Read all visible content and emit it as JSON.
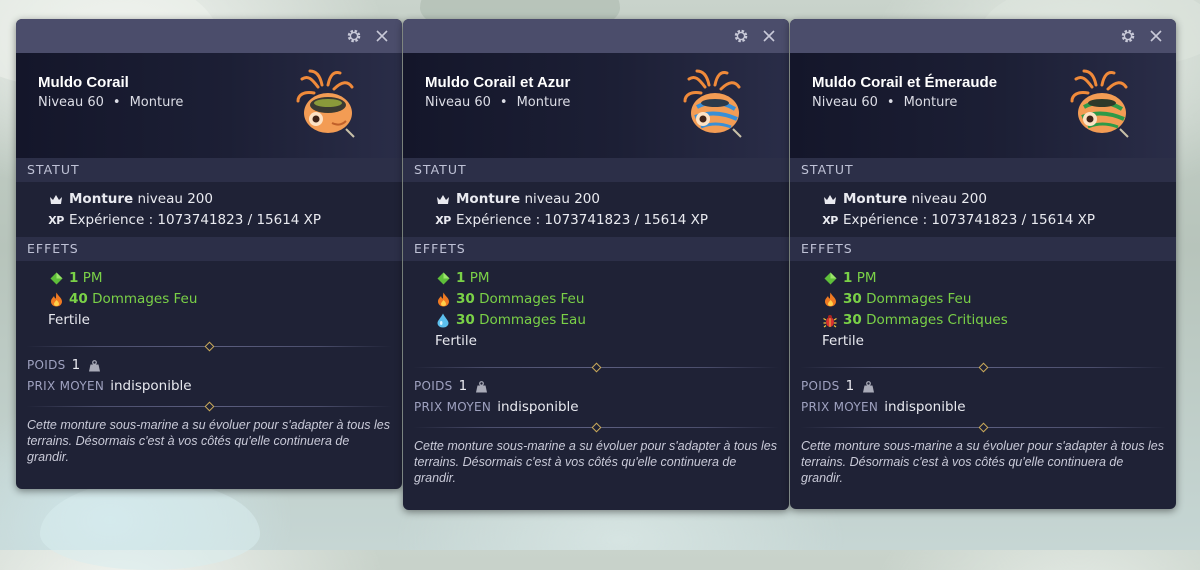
{
  "colors": {
    "card_bg": "#1f2236",
    "titlebar_bg": "#4b4d6b",
    "section_bg": "#2c2f48",
    "effect_green": "#7ad147",
    "ornament_gold": "#c9a95a"
  },
  "cards": [
    {
      "name": "Muldo Corail",
      "level": "Niveau 60",
      "separator": "•",
      "type": "Monture",
      "image_icon": "muldo-mount-image",
      "statut_header": "STATUT",
      "mount_label": "Monture",
      "mount_level": "niveau 200",
      "xp_icon": "XP",
      "experience": "Expérience : 1073741823 / 15614 XP",
      "effets_header": "EFFETS",
      "effects": [
        {
          "icon": "pm-diamond-icon",
          "value": "1",
          "label": "PM"
        },
        {
          "icon": "fire-icon",
          "value": "40",
          "label": "Dommages Feu"
        }
      ],
      "fertile": "Fertile",
      "poids_label": "POIDS",
      "poids_value": "1",
      "prix_label": "PRIX MOYEN",
      "prix_value": "indisponible",
      "description": "Cette monture sous-marine a su évoluer pour s'adapter à tous les terrains. Désormais c'est à vos côtés qu'elle continuera de grandir."
    },
    {
      "name": "Muldo Corail et Azur",
      "level": "Niveau 60",
      "separator": "•",
      "type": "Monture",
      "image_icon": "muldo-mount-image",
      "statut_header": "STATUT",
      "mount_label": "Monture",
      "mount_level": "niveau 200",
      "xp_icon": "XP",
      "experience": "Expérience : 1073741823 / 15614 XP",
      "effets_header": "EFFETS",
      "effects": [
        {
          "icon": "pm-diamond-icon",
          "value": "1",
          "label": "PM"
        },
        {
          "icon": "fire-icon",
          "value": "30",
          "label": "Dommages Feu"
        },
        {
          "icon": "water-drop-icon",
          "value": "30",
          "label": "Dommages Eau"
        }
      ],
      "fertile": "Fertile",
      "poids_label": "POIDS",
      "poids_value": "1",
      "prix_label": "PRIX MOYEN",
      "prix_value": "indisponible",
      "description": "Cette monture sous-marine a su évoluer pour s'adapter à tous les terrains. Désormais c'est à vos côtés qu'elle continuera de grandir."
    },
    {
      "name": "Muldo Corail et Émeraude",
      "level": "Niveau 60",
      "separator": "•",
      "type": "Monture",
      "image_icon": "muldo-mount-image",
      "statut_header": "STATUT",
      "mount_label": "Monture",
      "mount_level": "niveau 200",
      "xp_icon": "XP",
      "experience": "Expérience : 1073741823 / 15614 XP",
      "effets_header": "EFFETS",
      "effects": [
        {
          "icon": "pm-diamond-icon",
          "value": "1",
          "label": "PM"
        },
        {
          "icon": "fire-icon",
          "value": "30",
          "label": "Dommages Feu"
        },
        {
          "icon": "critical-bug-icon",
          "value": "30",
          "label": "Dommages Critiques"
        }
      ],
      "fertile": "Fertile",
      "poids_label": "POIDS",
      "poids_value": "1",
      "prix_label": "PRIX MOYEN",
      "prix_value": "indisponible",
      "description": "Cette monture sous-marine a su évoluer pour s'adapter à tous les terrains. Désormais c'est à vos côtés qu'elle continuera de grandir."
    }
  ]
}
